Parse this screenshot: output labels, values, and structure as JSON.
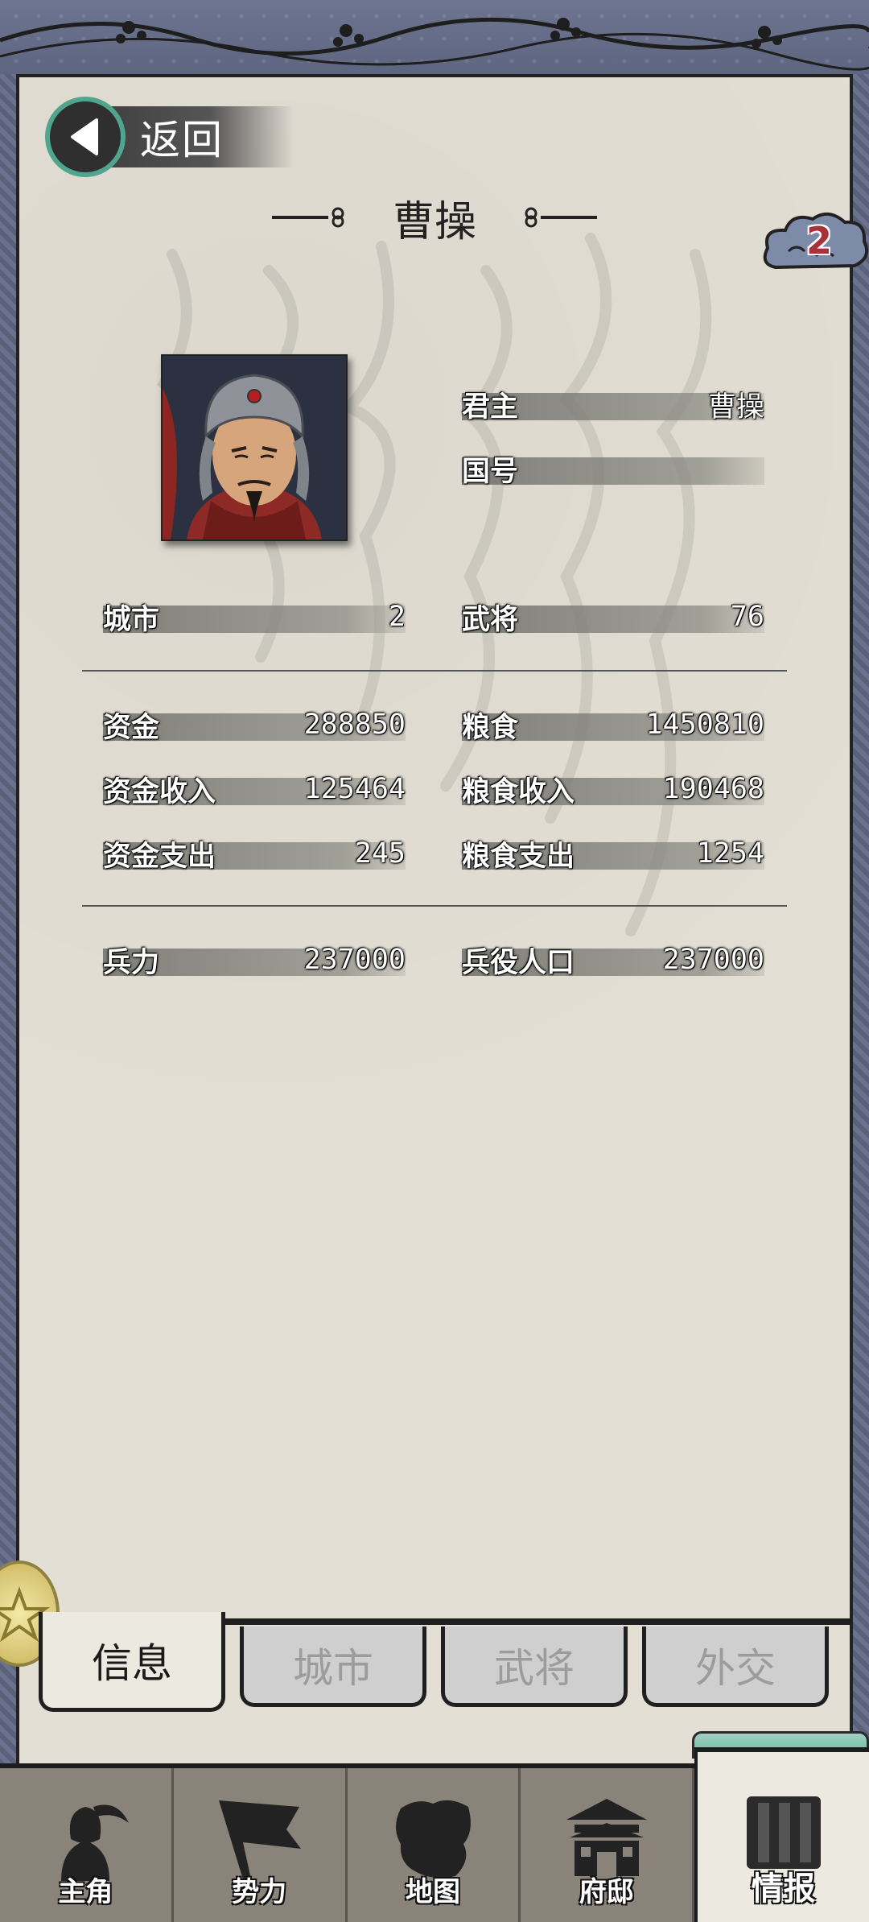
{
  "header": {
    "back_label": "返回",
    "title": "曹操",
    "badge_count": "2"
  },
  "ruler": [
    {
      "label": "君主",
      "value": "曹操"
    },
    {
      "label": "国号",
      "value": ""
    }
  ],
  "stats_group1": [
    {
      "label": "城市",
      "value": "2"
    },
    {
      "label": "武将",
      "value": "76"
    }
  ],
  "stats_group2": [
    {
      "label": "资金",
      "value": "288850"
    },
    {
      "label": "粮食",
      "value": "1450810"
    },
    {
      "label": "资金收入",
      "value": "125464"
    },
    {
      "label": "粮食收入",
      "value": "190468"
    },
    {
      "label": "资金支出",
      "value": "245"
    },
    {
      "label": "粮食支出",
      "value": "1254"
    }
  ],
  "stats_group3": [
    {
      "label": "兵力",
      "value": "237000"
    },
    {
      "label": "兵役人口",
      "value": "237000"
    }
  ],
  "sub_tabs": [
    "信息",
    "城市",
    "武将",
    "外交"
  ],
  "bottom_nav": [
    "主角",
    "势力",
    "地图",
    "府邸",
    "情报"
  ],
  "colors": {
    "accent_teal": "#4fa58e",
    "paper": "#e3dfd4",
    "frame": "#6d7590",
    "nav_bg": "#8a837a",
    "badge_red": "#a8323a"
  }
}
